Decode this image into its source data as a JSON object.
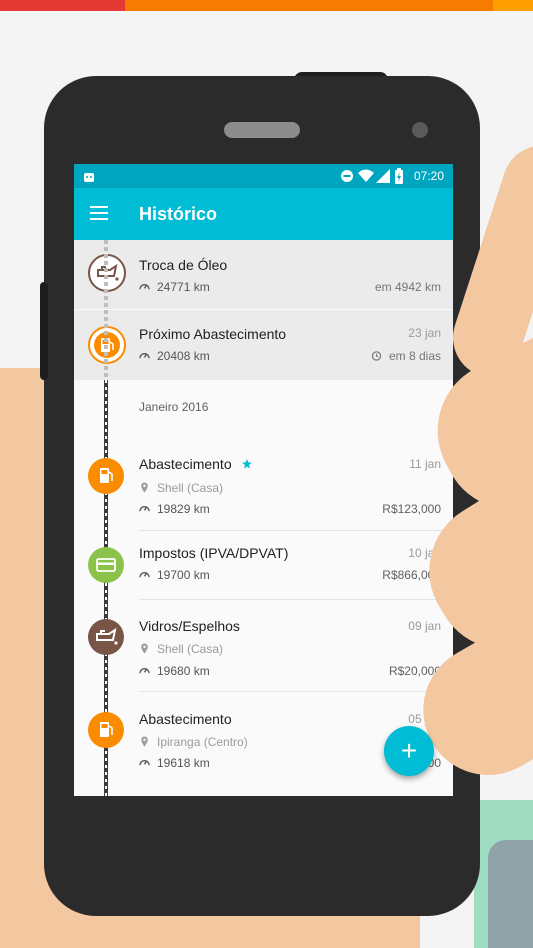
{
  "colors": {
    "accent": "#00bcd4",
    "status_bar": "#00a5bf",
    "orange": "#fb8c00",
    "brown": "#795548",
    "green": "#8bc34a",
    "skin": "#f3c8a0"
  },
  "status_bar": {
    "time": "07:20"
  },
  "app_bar": {
    "title": "Histórico",
    "menu_icon": "hamburger-menu-icon"
  },
  "upcoming": [
    {
      "icon": "oil-can-icon",
      "title": "Troca de Óleo",
      "odometer": "24771 km",
      "due": "em 4942 km"
    },
    {
      "icon": "fuel-pump-icon",
      "title": "Próximo Abastecimento",
      "date": "23 jan",
      "odometer": "20408 km",
      "due": "em 8 dias"
    }
  ],
  "month_header": "Janeiro 2016",
  "entries": [
    {
      "icon": "fuel-pump-icon",
      "title": "Abastecimento",
      "date": "11 jan",
      "place": "Shell (Casa)",
      "odometer": "19829 km",
      "amount": "R$123,000",
      "starred": true
    },
    {
      "icon": "credit-card-icon",
      "title": "Impostos (IPVA/DPVAT)",
      "date": "10 jan",
      "odometer": "19700 km",
      "amount": "R$866,000"
    },
    {
      "icon": "oil-can-icon",
      "title": "Vidros/Espelhos",
      "date": "09 jan",
      "place": "Shell (Casa)",
      "odometer": "19680 km",
      "amount": "R$20,000"
    },
    {
      "icon": "fuel-pump-icon",
      "title": "Abastecimento",
      "date": "05 jan",
      "place": "Ipiranga (Centro)",
      "odometer": "19618 km",
      "amount": "R$50,000"
    }
  ],
  "fab": {
    "label": "+"
  }
}
